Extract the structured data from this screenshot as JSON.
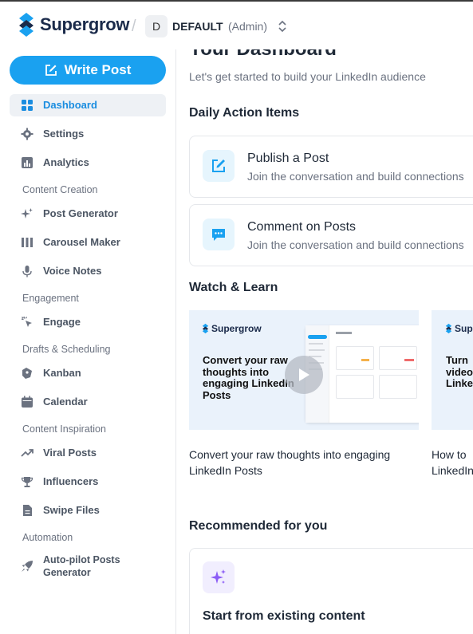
{
  "header": {
    "brand": "Supergrow",
    "workspace_initial": "D",
    "workspace_name": "DEFAULT",
    "workspace_role": "(Admin)"
  },
  "sidebar": {
    "write_post_label": "Write Post",
    "items": {
      "dashboard": "Dashboard",
      "settings": "Settings",
      "analytics": "Analytics",
      "post_generator": "Post Generator",
      "carousel_maker": "Carousel Maker",
      "voice_notes": "Voice Notes",
      "engage": "Engage",
      "kanban": "Kanban",
      "calendar": "Calendar",
      "viral_posts": "Viral Posts",
      "influencers": "Influencers",
      "swipe_files": "Swipe Files",
      "autopilot_line1": "Auto-pilot Posts",
      "autopilot_line2": "Generator"
    },
    "sections": {
      "content_creation": "Content Creation",
      "engagement": "Engagement",
      "drafts_scheduling": "Drafts & Scheduling",
      "content_inspiration": "Content Inspiration",
      "automation": "Automation"
    }
  },
  "main": {
    "title": "Your Dashboard",
    "subtitle": "Let's get started to build your LinkedIn audience",
    "daily_heading": "Daily Action Items",
    "actions": [
      {
        "title": "Publish a Post",
        "desc": "Join the conversation and build connections"
      },
      {
        "title": "Comment on Posts",
        "desc": "Join the conversation and build connections"
      }
    ],
    "watch_heading": "Watch & Learn",
    "videos": [
      {
        "brand": "Supergrow",
        "thumb_text": "Convert your raw thoughts into engaging LinkedIn Posts",
        "caption_line1": "Convert your raw thoughts into engaging",
        "caption_line2": "LinkedIn Posts"
      },
      {
        "brand": "Supe",
        "thumb_text": "Turn video Linke",
        "caption_line1": "How to",
        "caption_line2": "LinkedIn"
      }
    ],
    "reco_heading": "Recommended for you",
    "reco_card_title": "Start from existing content"
  },
  "colors": {
    "accent": "#1aa1f0",
    "active_text": "#1a8de0",
    "icon_bg": "#e6f5fd",
    "reco_icon": "#8b5cf6"
  }
}
